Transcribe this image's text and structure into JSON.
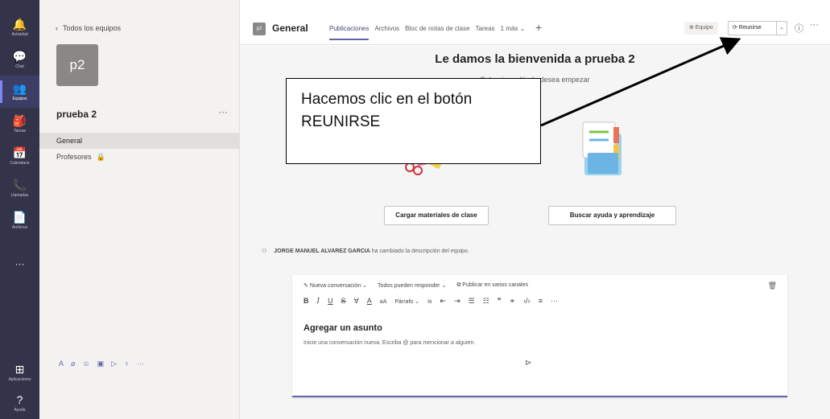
{
  "rail": {
    "items": [
      {
        "label": "Actividad",
        "icon": "bell-icon",
        "glyph": "🔔"
      },
      {
        "label": "Chat",
        "icon": "chat-icon",
        "glyph": "💬"
      },
      {
        "label": "Equipos",
        "icon": "teams-icon",
        "glyph": "👥"
      },
      {
        "label": "Tareas",
        "icon": "assignments-icon",
        "glyph": "🎒"
      },
      {
        "label": "Calendario",
        "icon": "calendar-icon",
        "glyph": "📅"
      },
      {
        "label": "Llamadas",
        "icon": "phone-icon",
        "glyph": "📞"
      },
      {
        "label": "Archivos",
        "icon": "files-icon",
        "glyph": "📄"
      }
    ],
    "more": "···",
    "apps_label": "Aplicaciones",
    "help_label": "Ayuda",
    "active_index": 2
  },
  "team_panel": {
    "back_label": "Todos los equipos",
    "avatar_text": "p2",
    "team_name": "prueba 2",
    "more": "···",
    "channels": [
      {
        "label": "General",
        "active": true,
        "locked": false
      },
      {
        "label": "Profesores",
        "active": false,
        "locked": true
      }
    ]
  },
  "header": {
    "avatar_text": "p2",
    "channel_title": "General",
    "tabs": [
      "Publicaciones",
      "Archivos",
      "Bloc de notas de clase",
      "Tareas",
      "1 más ⌄"
    ],
    "active_tab": 0,
    "add_tab": "+",
    "team_pill": "⊕ Equipo",
    "meet_label": "⟳ Reunirse",
    "meet_dropdown": "⌄",
    "info_icon": "ⓘ",
    "more": "···"
  },
  "main": {
    "welcome_title": "Le damos la bienvenida a prueba 2",
    "welcome_subtitle": "Seleccione dónde desea empezar",
    "card_buttons": [
      "Cargar materiales de clase",
      "Buscar ayuda y aprendizaje"
    ],
    "activity_author": "JORGE MANUEL ALVAREZ GARCIA",
    "activity_text": "ha cambiado la descripción del equipo."
  },
  "compose": {
    "new_conversation": "Nueva conversación ⌄",
    "reply_setting": "Todos pueden responder ⌄",
    "publish_channels": "Publicar en varios canales",
    "format": {
      "bold": "B",
      "italic": "I",
      "underline": "U",
      "strike": "S",
      "highlight": "∀",
      "font_color": "A",
      "font_size": "aA",
      "paragraph": "Párrafo ⌄",
      "clear_format": "Ix",
      "outdent": "⇤",
      "indent": "⇥",
      "bullets": "☰",
      "numbers": "☷",
      "quote": "❞",
      "link": "⚭",
      "code": "‹/›",
      "rule": "≡",
      "more": "···"
    },
    "subject_placeholder": "Agregar un asunto",
    "body_placeholder": "Inicie una conversación nueva. Escriba @ para mencionar a alguien."
  },
  "bottom_tools": [
    "A",
    "⌀",
    "☺",
    "▣",
    "▷",
    "♀",
    "···"
  ],
  "send_icon": "⊳",
  "annotation": {
    "callout_text": "Hacemos clic en el botón\nREUNIRSE"
  },
  "colors": {
    "rail": "#33344a",
    "accent": "#6264a7",
    "panel": "#f3f2f1",
    "main": "#f5f5f5"
  }
}
